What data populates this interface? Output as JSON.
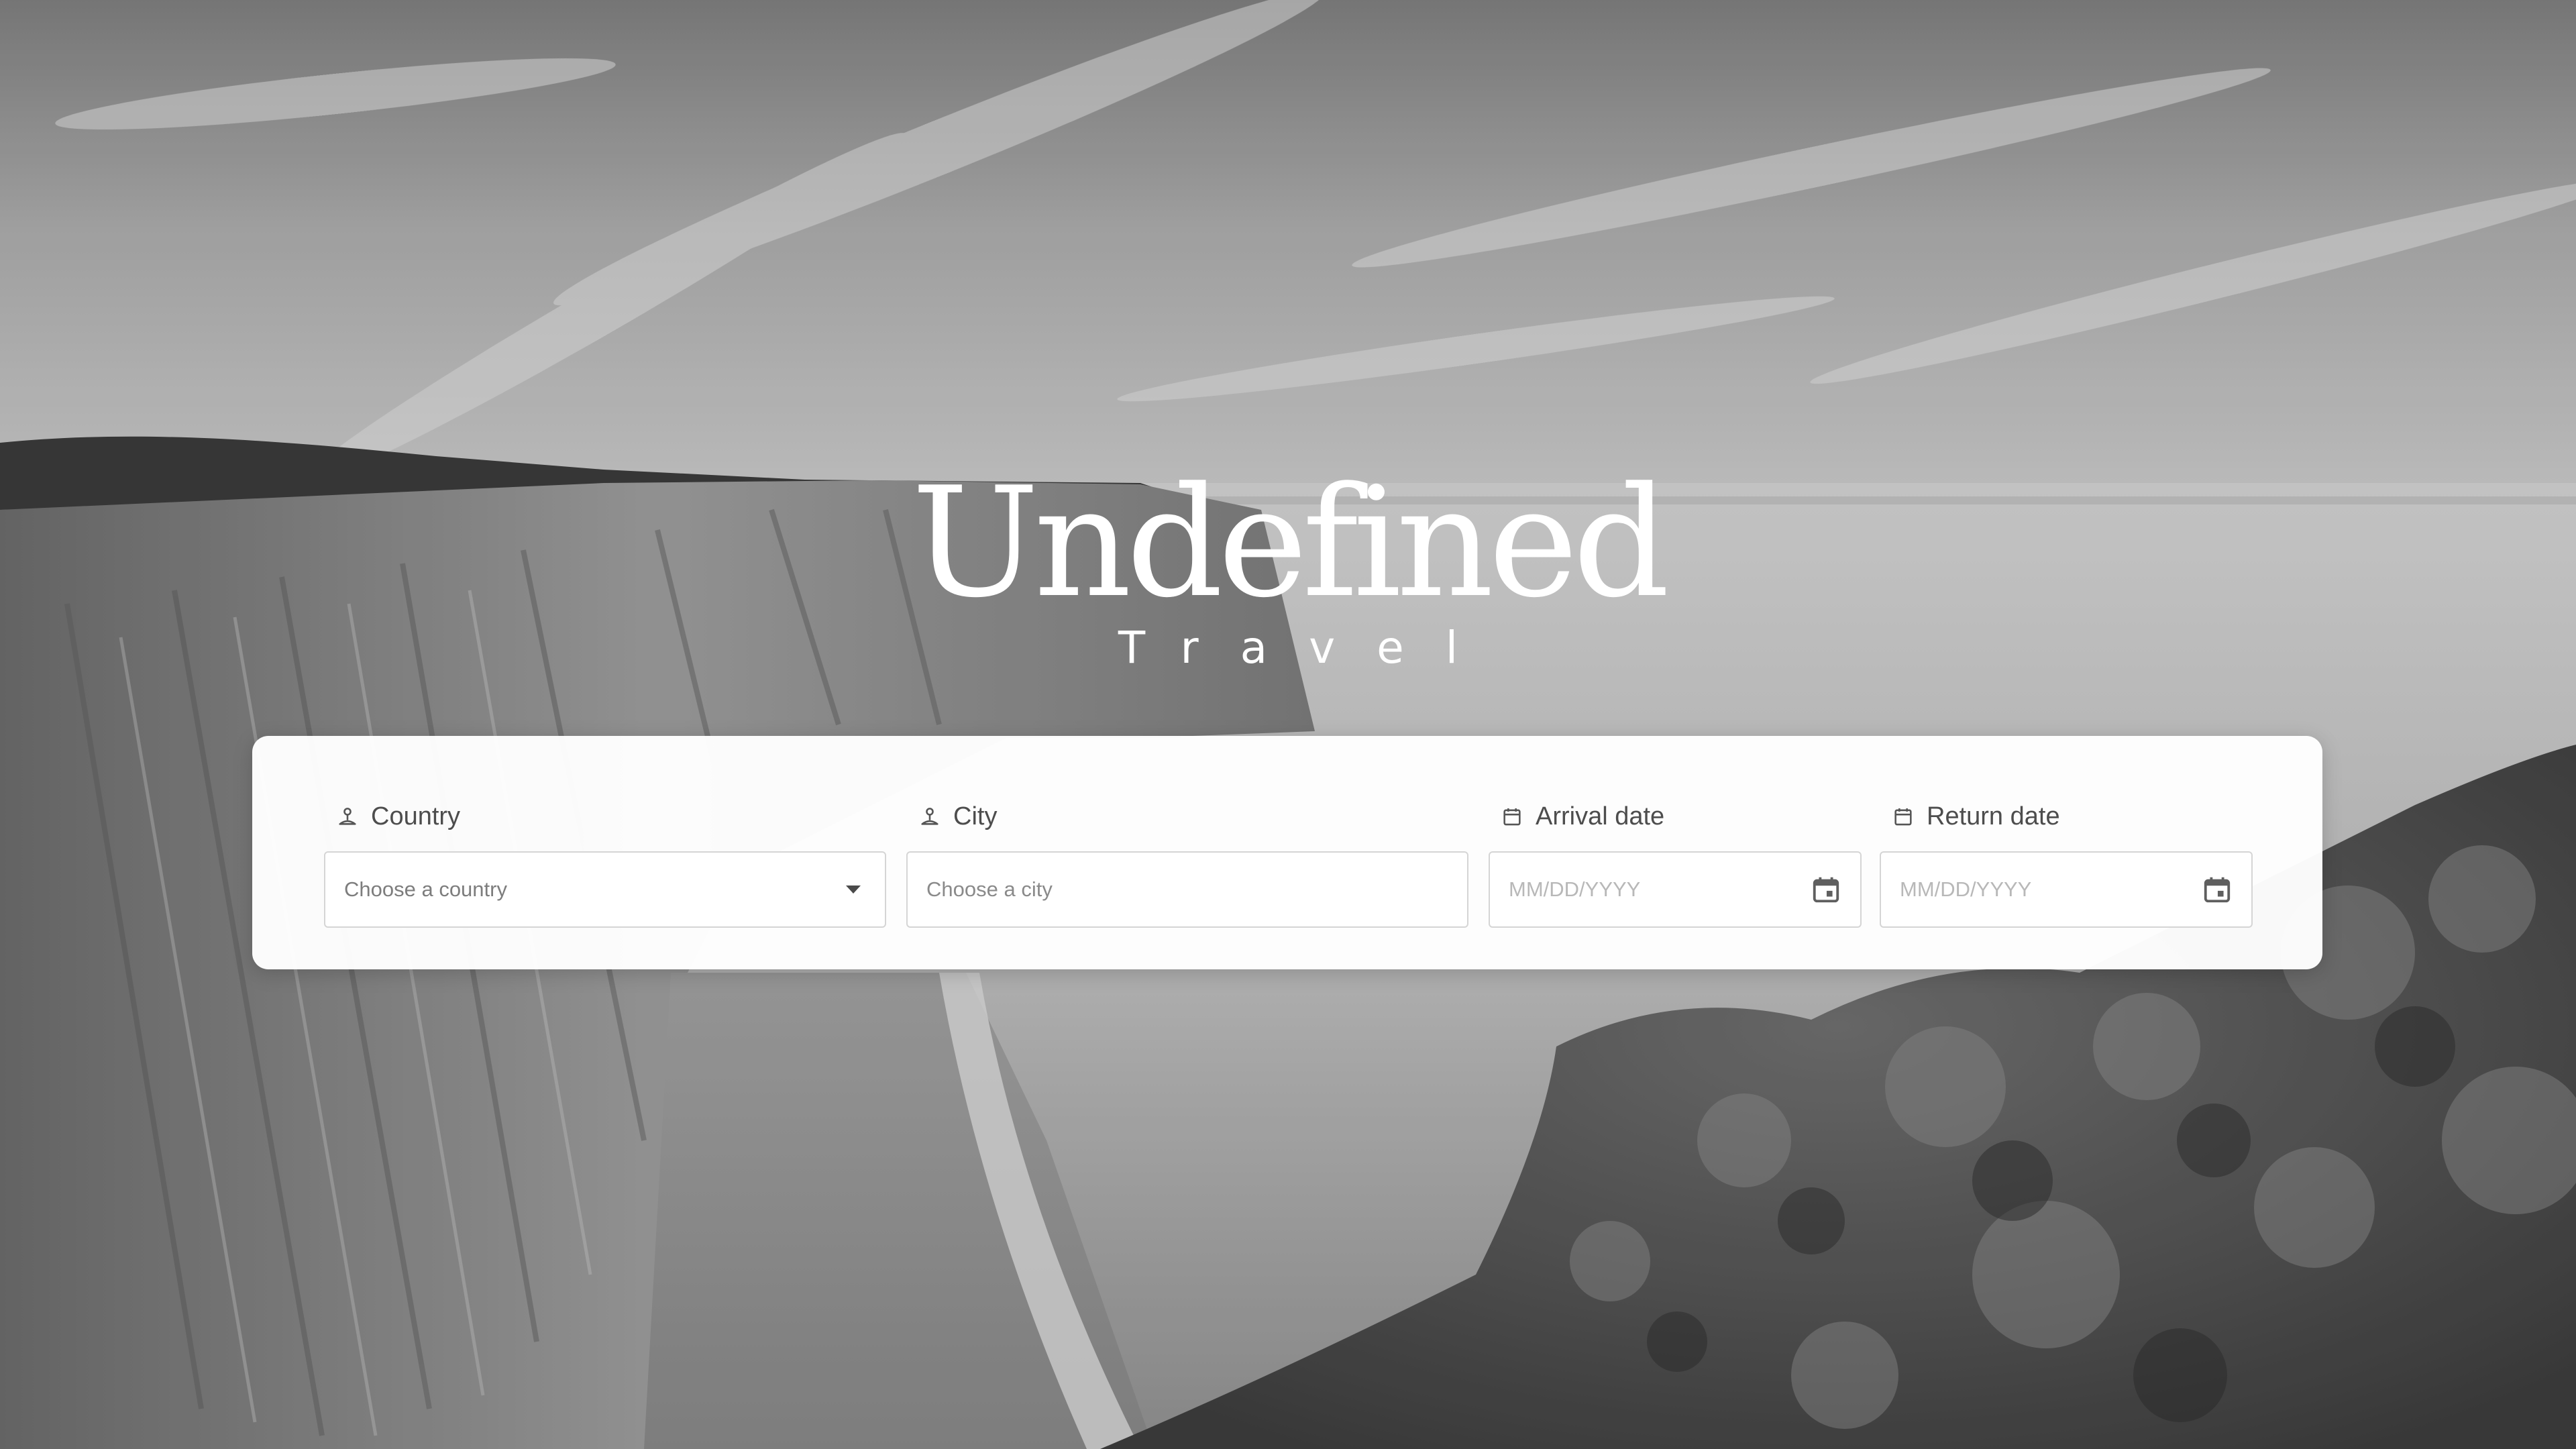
{
  "brand": {
    "title": "Undefined",
    "subtitle": "Travel"
  },
  "search": {
    "country": {
      "label": "Country",
      "icon": "person-pin-icon",
      "placeholder": "Choose a country",
      "dropdown_icon": "chevron-down-icon"
    },
    "city": {
      "label": "City",
      "icon": "person-pin-icon",
      "placeholder": "Choose a city"
    },
    "arrival": {
      "label": "Arrival date",
      "icon": "calendar-icon",
      "placeholder": "MM/DD/YYYY",
      "picker_icon": "calendar-icon"
    },
    "return": {
      "label": "Return date",
      "icon": "calendar-icon",
      "placeholder": "MM/DD/YYYY",
      "picker_icon": "calendar-icon"
    }
  },
  "colors": {
    "card": "#ffffff",
    "label": "#4d4d4d",
    "border": "#d5d5d5",
    "brand_text": "#ffffff"
  }
}
